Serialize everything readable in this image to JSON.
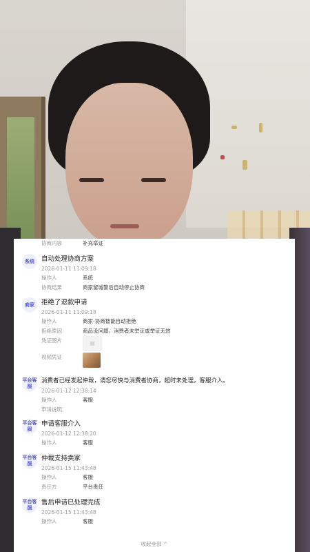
{
  "top_partial": {
    "label": "协商内容",
    "value": "补充举证"
  },
  "entries": [
    {
      "badge": "系统",
      "title": "自动处理协商方案",
      "time": "2026-01-11 11:09:18",
      "rows": [
        {
          "label": "操作人",
          "value": "系统"
        },
        {
          "label": "协商结果",
          "value": "商家留城警后自动停止协商"
        }
      ]
    },
    {
      "badge": "商家",
      "title": "拒绝了退款申请",
      "time": "2026-01-11 11:09:18",
      "rows": [
        {
          "label": "操作人",
          "value": "商家-协商智能自动拒绝"
        },
        {
          "label": "拒绝原因",
          "value": "商品没问题，消费者未举证或举证无效"
        }
      ],
      "evidence_label": "凭证图片",
      "video_label": "视频凭证"
    },
    {
      "badge": "平台客服",
      "title": "消费者已经发起仲裁，请您尽快与消费者协商，超时未处理，客服介入。",
      "time": "2026-01-12 12:38:14",
      "rows": [
        {
          "label": "操作人",
          "value": "客服"
        }
      ],
      "extra": "申请说明"
    },
    {
      "badge": "平台客服",
      "title": "申请客服介入",
      "time": "2026-01-12 12:38:20",
      "rows": [
        {
          "label": "操作人",
          "value": "客服"
        }
      ]
    },
    {
      "badge": "平台客服",
      "title": "仲裁支持卖家",
      "time": "2026-01-15 11:43:48",
      "rows": [
        {
          "label": "操作人",
          "value": "客服"
        },
        {
          "label": "责任方",
          "value": "平台责任"
        }
      ]
    },
    {
      "badge": "平台客服",
      "title": "售后申请已处理完成",
      "time": "2026-01-15 11:43:48",
      "rows": [
        {
          "label": "操作人",
          "value": "客服"
        }
      ]
    }
  ],
  "footer": {
    "collapse_label": "收起全部 ^"
  }
}
